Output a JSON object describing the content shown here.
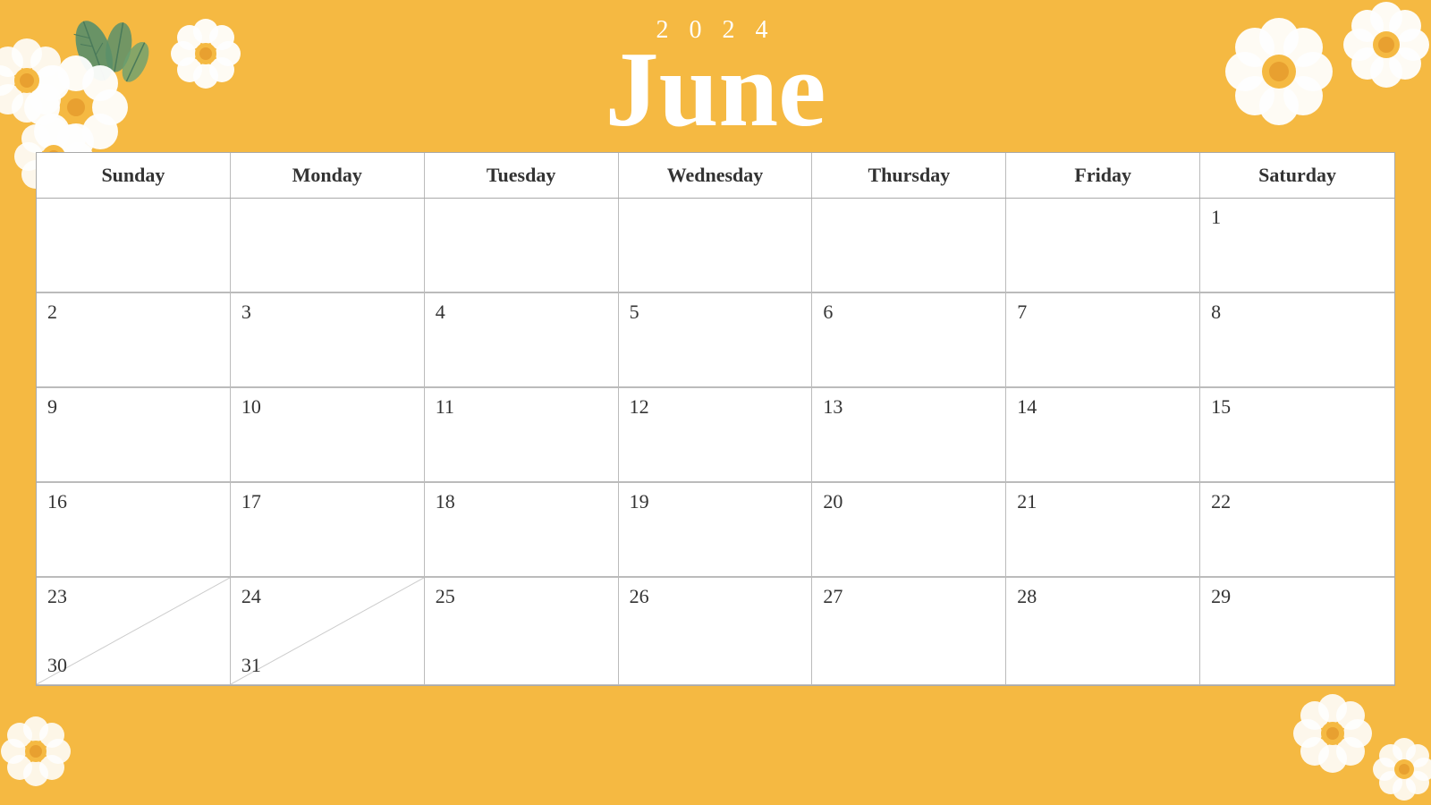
{
  "header": {
    "year": "2 0 2 4",
    "month": "June"
  },
  "calendar": {
    "days_of_week": [
      "Sunday",
      "Monday",
      "Tuesday",
      "Wednesday",
      "Thursday",
      "Friday",
      "Saturday"
    ],
    "weeks": [
      [
        null,
        null,
        null,
        null,
        null,
        null,
        1
      ],
      [
        2,
        3,
        4,
        5,
        6,
        7,
        8
      ],
      [
        9,
        10,
        11,
        12,
        13,
        14,
        15
      ],
      [
        16,
        17,
        18,
        19,
        20,
        21,
        22
      ],
      [
        "23/30",
        "24/31",
        25,
        26,
        27,
        28,
        29
      ]
    ]
  },
  "colors": {
    "background": "#F5B942",
    "white": "#FFFFFF",
    "text_dark": "#333333",
    "border": "#AAAAAA"
  }
}
